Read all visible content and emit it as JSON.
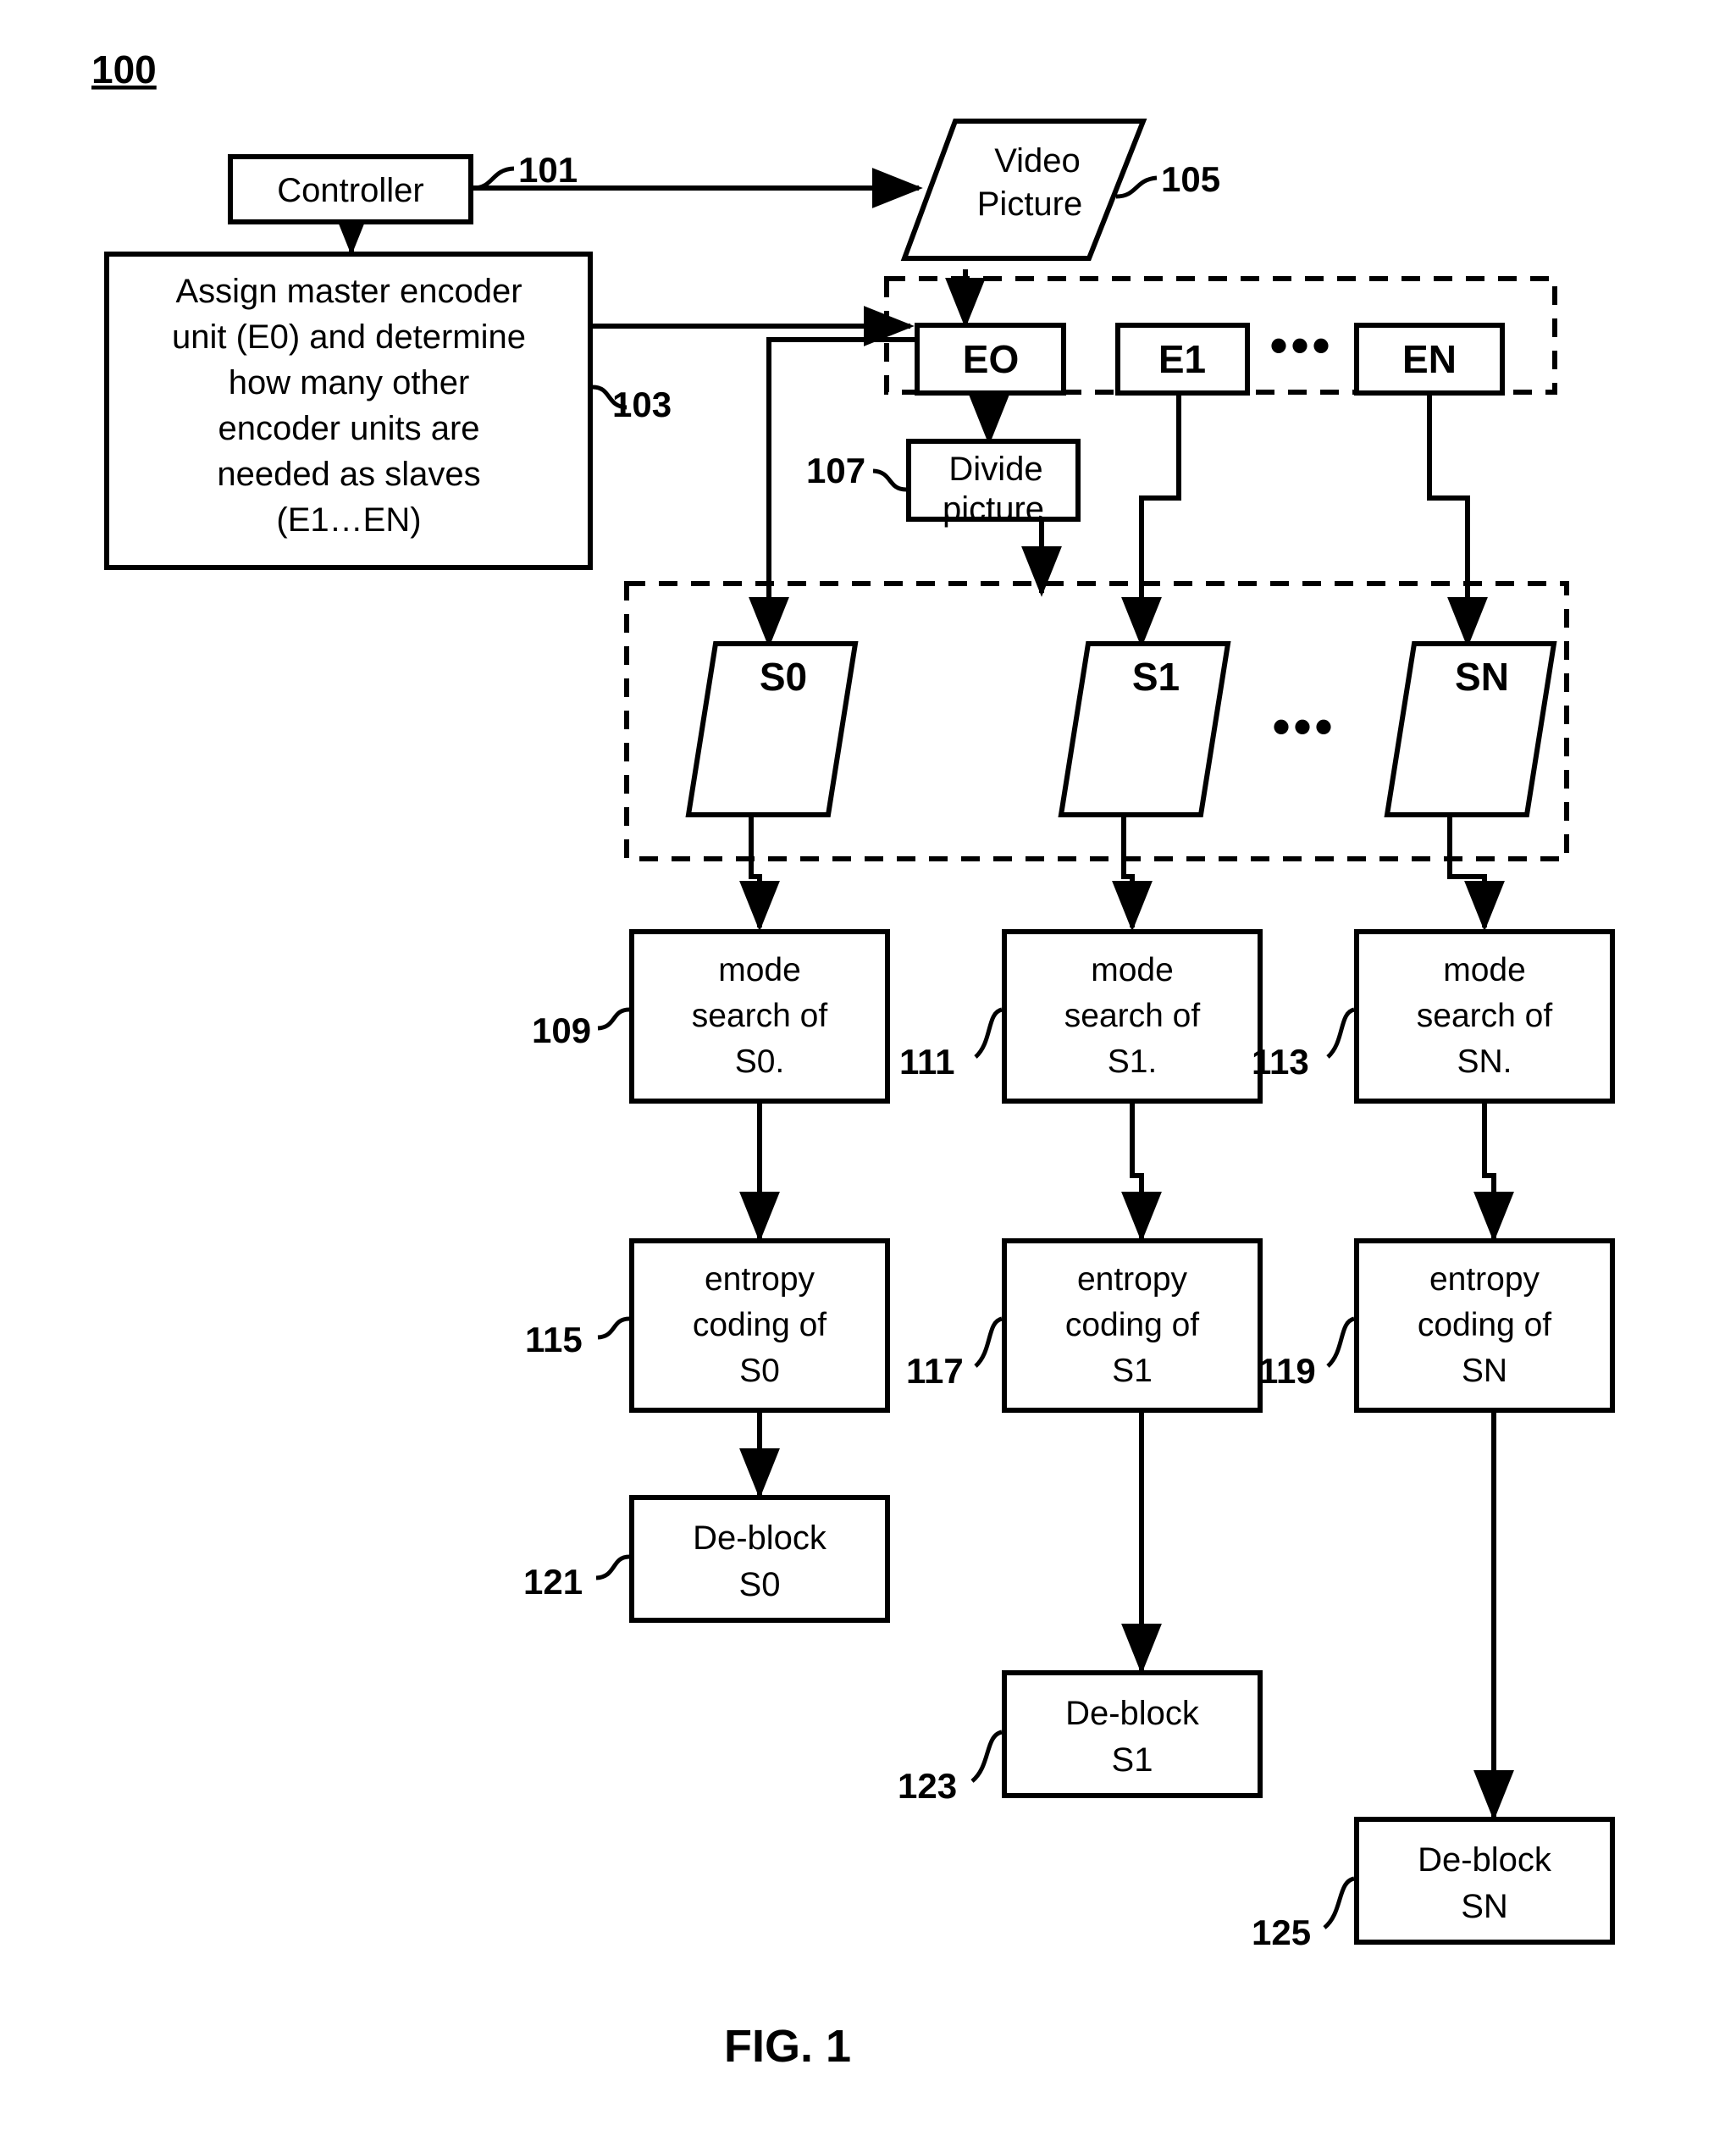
{
  "figure": {
    "number_label": "100",
    "caption": "FIG. 1"
  },
  "nodes": {
    "controller": {
      "label": "Controller",
      "ref": "101"
    },
    "assign": {
      "lines": [
        "Assign master encoder",
        "unit (E0) and determine",
        "how many other",
        "encoder units are",
        "needed as slaves",
        "(E1…EN)"
      ],
      "ref": "103"
    },
    "video_picture": {
      "lines": [
        "Video",
        "Picture"
      ],
      "ref": "105"
    },
    "divide_picture": {
      "lines": [
        "Divide",
        "picture"
      ],
      "ref": "107"
    }
  },
  "encoder_units": {
    "items": [
      {
        "label": "EO"
      },
      {
        "label": "E1"
      },
      {
        "label": "EN"
      }
    ],
    "ellipsis": "•••"
  },
  "slices": {
    "items": [
      {
        "label": "S0"
      },
      {
        "label": "S1"
      },
      {
        "label": "SN"
      }
    ],
    "ellipsis": "•••"
  },
  "mode_search": [
    {
      "lines": [
        "mode",
        "search of",
        "S0."
      ],
      "ref": "109"
    },
    {
      "lines": [
        "mode",
        "search of",
        "S1."
      ],
      "ref": "111"
    },
    {
      "lines": [
        "mode",
        "search of",
        "SN."
      ],
      "ref": "113"
    }
  ],
  "entropy_coding": [
    {
      "lines": [
        "entropy",
        "coding of",
        "S0"
      ],
      "ref": "115"
    },
    {
      "lines": [
        "entropy",
        "coding of",
        "S1"
      ],
      "ref": "117"
    },
    {
      "lines": [
        "entropy",
        "coding of",
        "SN"
      ],
      "ref": "119"
    }
  ],
  "deblock": [
    {
      "lines": [
        "De-block",
        "S0"
      ],
      "ref": "121"
    },
    {
      "lines": [
        "De-block",
        "S1"
      ],
      "ref": "123"
    },
    {
      "lines": [
        "De-block",
        "SN"
      ],
      "ref": "125"
    }
  ],
  "colors": {
    "stroke": "#000000",
    "fill": "#ffffff"
  }
}
